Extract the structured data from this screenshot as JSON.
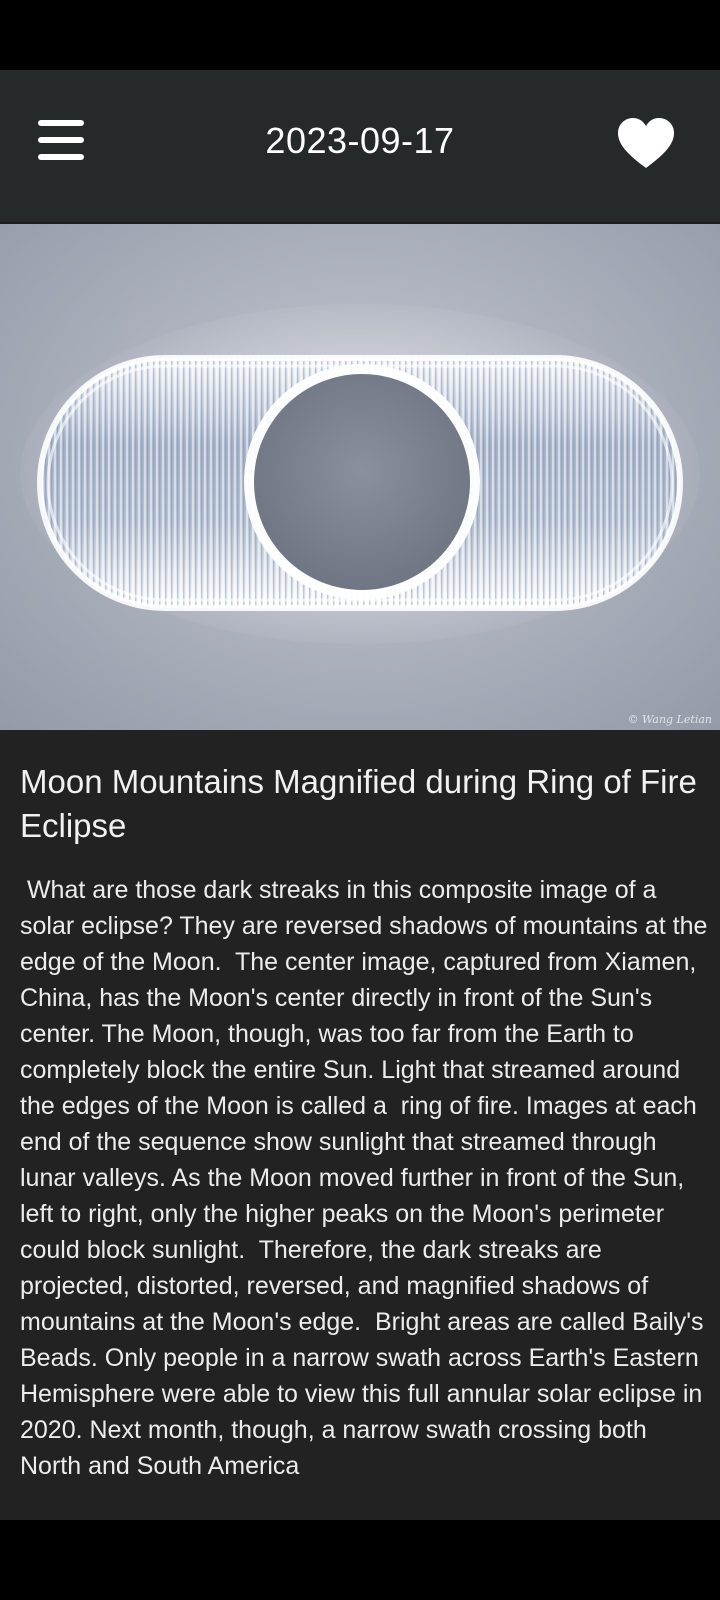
{
  "app_bar": {
    "date": "2023-09-17",
    "menu_icon": "hamburger-menu-icon",
    "favorite_icon": "heart-icon"
  },
  "image": {
    "description_icon": "eclipse-photo",
    "credit": "© Wang Letian"
  },
  "article": {
    "title": " Moon Mountains Magnified during Ring of Fire Eclipse",
    "body": " What are those dark streaks in this composite image of a solar eclipse? They are reversed shadows of mountains at the edge of the Moon.  The center image, captured from Xiamen, China, has the Moon's center directly in front of the Sun's center. The Moon, though, was too far from the Earth to completely block the entire Sun. Light that streamed around the edges of the Moon is called a  ring of fire. Images at each end of the sequence show sunlight that streamed through lunar valleys. As the Moon moved further in front of the Sun, left to right, only the higher peaks on the Moon's perimeter could block sunlight.  Therefore, the dark streaks are projected, distorted, reversed, and magnified shadows of mountains at the Moon's edge.  Bright areas are called Baily's Beads. Only people in a narrow swath across Earth's Eastern Hemisphere were able to view this full annular solar eclipse in 2020. Next month, though, a narrow swath crossing both North and South America"
  },
  "colors": {
    "app_bar": "#25292a",
    "content_bg": "#222222",
    "text": "#ececec"
  }
}
